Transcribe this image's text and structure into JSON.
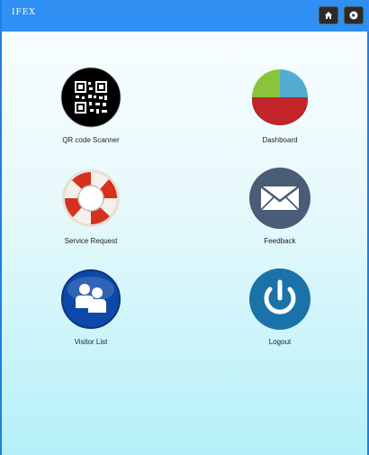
{
  "header": {
    "title": "IFEX",
    "home_icon": "home-icon",
    "back_icon": "back-arrow-icon"
  },
  "tiles": [
    {
      "label": "QR code Scanner",
      "icon": "qr-code-icon"
    },
    {
      "label": "Dashboard",
      "icon": "pie-chart-icon"
    },
    {
      "label": "Service Request",
      "icon": "lifebuoy-icon"
    },
    {
      "label": "Feedback",
      "icon": "envelope-icon"
    },
    {
      "label": "Visitor List",
      "icon": "people-icon"
    },
    {
      "label": "Logout",
      "icon": "power-icon"
    }
  ],
  "colors": {
    "header": "#2f8ff2",
    "feedback_circle": "#4b5c77",
    "logout_circle": "#1a72a8",
    "visitor_circle": "#0d49a8"
  }
}
